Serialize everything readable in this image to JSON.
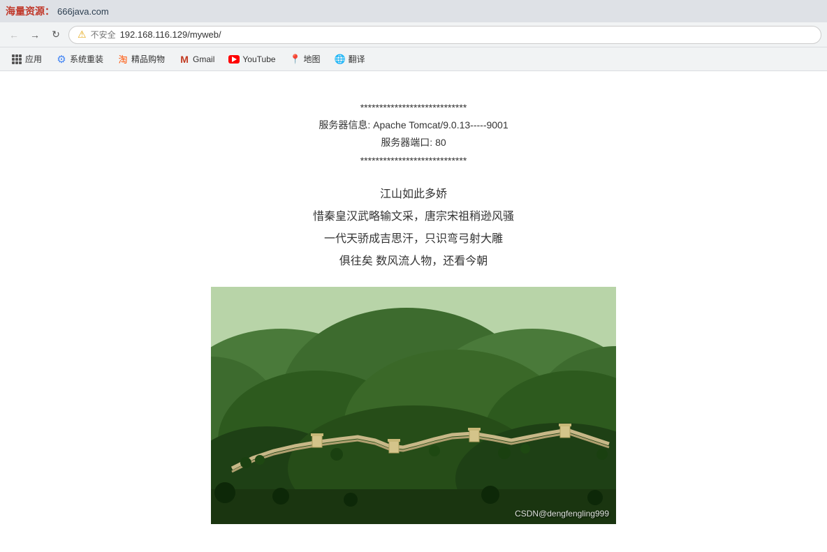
{
  "titlebar": {
    "brand_text": "海量资源：",
    "domain": "666java.com"
  },
  "addressbar": {
    "back_label": "←",
    "forward_label": "→",
    "reload_label": "↻",
    "warning_label": "⚠",
    "not_secure_label": "不安全",
    "url": "192.168.116.129/myweb/"
  },
  "bookmarks": {
    "apps_label": "应用",
    "system_label": "系统重装",
    "taobao_label": "精品购物",
    "gmail_label": "Gmail",
    "youtube_label": "YouTube",
    "maps_label": "地图",
    "translate_label": "翻译"
  },
  "server_info": {
    "line1": "****************************",
    "line2": "服务器信息: Apache Tomcat/9.0.13-----9001",
    "line3": "服务器端口: 80",
    "line4": "****************************"
  },
  "poem": {
    "title": "江山如此多娇",
    "line1": "惜秦皇汉武略输文采，唐宗宋祖稍逊风骚",
    "line2": "一代天骄成吉思汗，只识弯弓射大雕",
    "line3": "俱往矣 数风流人物，还看今朝"
  },
  "watermark": {
    "text": "CSDN@dengfengling999"
  }
}
